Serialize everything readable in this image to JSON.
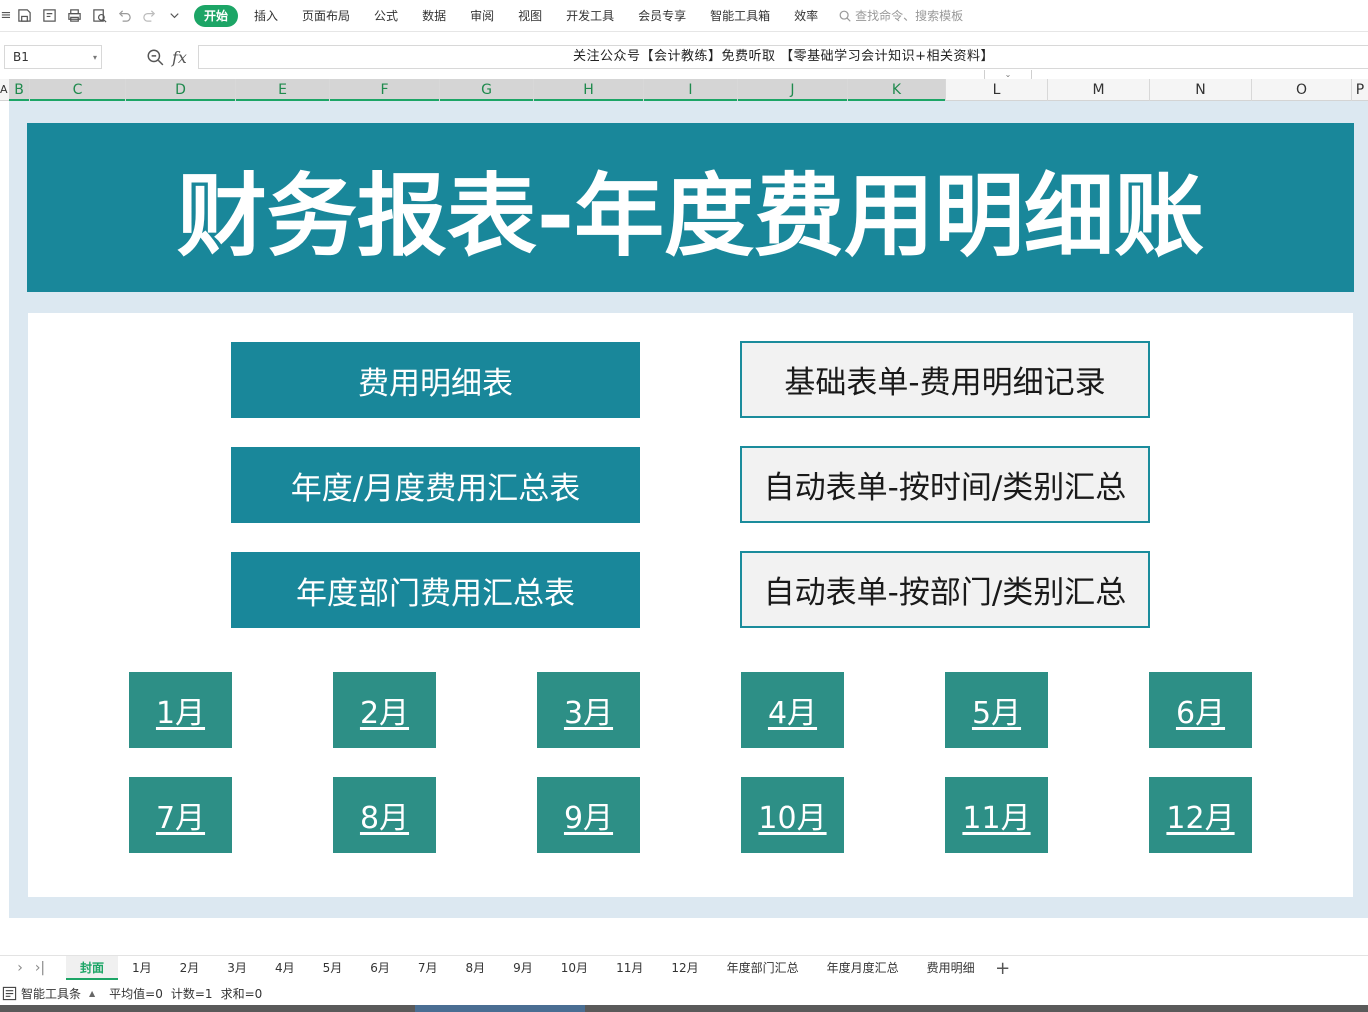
{
  "menubar": {
    "left_fragment": "≡",
    "items": [
      "开始",
      "插入",
      "页面布局",
      "公式",
      "数据",
      "审阅",
      "视图",
      "开发工具",
      "会员专享",
      "智能工具箱",
      "效率"
    ],
    "active_index": 0,
    "search_placeholder": "查找命令、搜索模板",
    "accent_color": "#1ca566"
  },
  "formula_bar": {
    "cell_ref": "B1",
    "fx_label": "fx",
    "content": "关注公众号【会计教练】免费听取 【零基础学习会计知识+相关资料】"
  },
  "columns": {
    "a_fragment": "A",
    "selected": [
      "B",
      "C",
      "D",
      "E",
      "F",
      "G",
      "H",
      "I",
      "J",
      "K"
    ],
    "others": [
      "L",
      "M",
      "N",
      "O",
      "P"
    ]
  },
  "sheet": {
    "title": "财务报表-年度费用明细账",
    "banner_color": "#19879a",
    "left_buttons": [
      "费用明细表",
      "年度/月度费用汇总表",
      "年度部门费用汇总表"
    ],
    "right_buttons": [
      "基础表单-费用明细记录",
      "自动表单-按时间/类别汇总",
      "自动表单-按部门/类别汇总"
    ],
    "month_buttons_row1": [
      "1月",
      "2月",
      "3月",
      "4月",
      "5月",
      "6月"
    ],
    "month_buttons_row2": [
      "7月",
      "8月",
      "9月",
      "10月",
      "11月",
      "12月"
    ],
    "month_color": "#2d8f86"
  },
  "tabs": {
    "items": [
      "封面",
      "1月",
      "2月",
      "3月",
      "4月",
      "5月",
      "6月",
      "7月",
      "8月",
      "9月",
      "10月",
      "11月",
      "12月",
      "年度部门汇总",
      "年度月度汇总",
      "费用明细"
    ],
    "active_index": 0,
    "add_label": "+"
  },
  "status": {
    "toolset_label": "智能工具条",
    "average": "平均值=0",
    "count": "计数=1",
    "sum": "求和=0"
  }
}
